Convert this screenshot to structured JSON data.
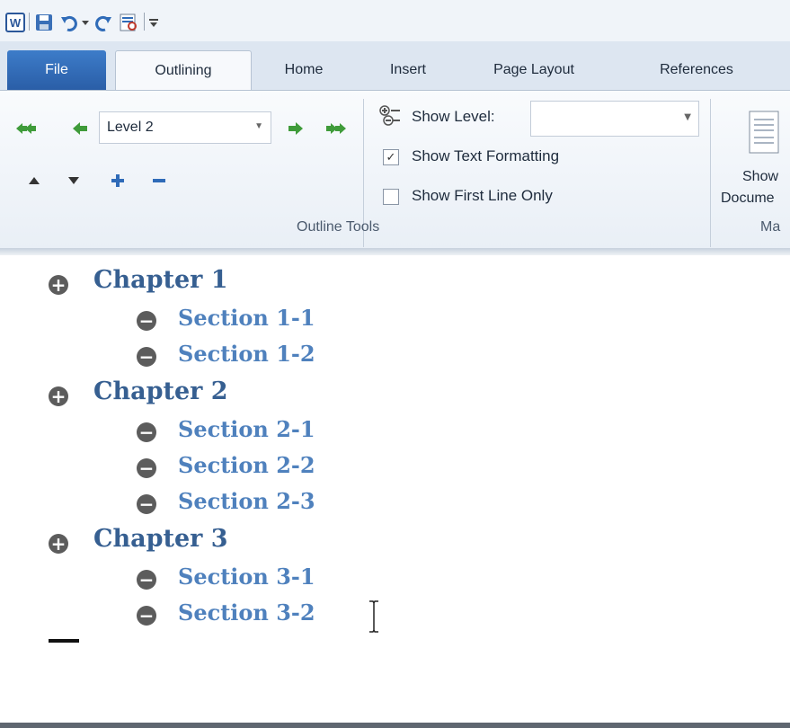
{
  "tabs": {
    "file": "File",
    "outlining": "Outlining",
    "home": "Home",
    "insert": "Insert",
    "page_layout": "Page Layout",
    "references": "References"
  },
  "outline_tools": {
    "level_value": "Level 2",
    "show_level_label": "Show Level:",
    "show_level_value": "",
    "show_text_formatting": {
      "label": "Show Text Formatting",
      "checked": true
    },
    "show_first_line_only": {
      "label": "Show First Line Only",
      "checked": false
    },
    "group_label": "Outline Tools"
  },
  "master_document": {
    "show_document_label_1": "Show",
    "show_document_label_2": "Docume",
    "group_label_partial": "Ma"
  },
  "document": {
    "items": [
      {
        "level": 1,
        "text": "Chapter 1",
        "symbol": "+"
      },
      {
        "level": 2,
        "text": "Section 1-1",
        "symbol": "−"
      },
      {
        "level": 2,
        "text": "Section 1-2",
        "symbol": "−"
      },
      {
        "level": 1,
        "text": "Chapter 2",
        "symbol": "+"
      },
      {
        "level": 2,
        "text": "Section 2-1",
        "symbol": "−"
      },
      {
        "level": 2,
        "text": "Section 2-2",
        "symbol": "−"
      },
      {
        "level": 2,
        "text": "Section 2-3",
        "symbol": "−"
      },
      {
        "level": 1,
        "text": "Chapter 3",
        "symbol": "+"
      },
      {
        "level": 2,
        "text": "Section 3-1",
        "symbol": "−"
      },
      {
        "level": 2,
        "text": "Section 3-2",
        "symbol": "−"
      }
    ]
  },
  "colors": {
    "heading1": "#365f91",
    "heading2": "#4f81bd",
    "file_tab": "#2f6bb8"
  }
}
